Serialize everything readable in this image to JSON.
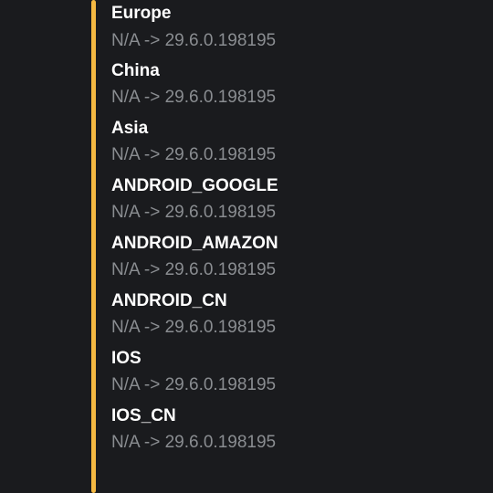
{
  "entries": [
    {
      "name": "Europe",
      "version": "N/A -> 29.6.0.198195"
    },
    {
      "name": "China",
      "version": "N/A -> 29.6.0.198195"
    },
    {
      "name": "Asia",
      "version": "N/A -> 29.6.0.198195"
    },
    {
      "name": "ANDROID_GOOGLE",
      "version": "N/A -> 29.6.0.198195"
    },
    {
      "name": "ANDROID_AMAZON",
      "version": "N/A -> 29.6.0.198195"
    },
    {
      "name": "ANDROID_CN",
      "version": "N/A -> 29.6.0.198195"
    },
    {
      "name": "IOS",
      "version": "N/A -> 29.6.0.198195"
    },
    {
      "name": "IOS_CN",
      "version": "N/A -> 29.6.0.198195"
    }
  ]
}
